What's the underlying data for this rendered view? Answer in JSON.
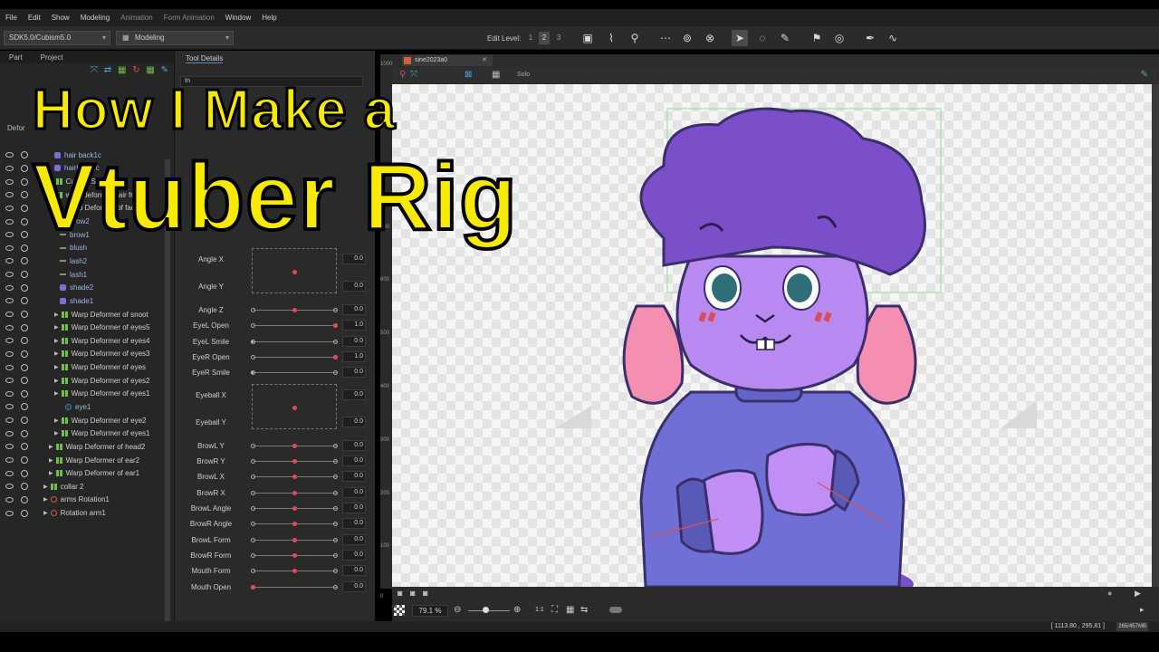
{
  "menu": [
    {
      "label": "File",
      "enabled": true
    },
    {
      "label": "Edit",
      "enabled": true
    },
    {
      "label": "Show",
      "enabled": true
    },
    {
      "label": "Modeling",
      "enabled": true
    },
    {
      "label": "Animation",
      "enabled": false
    },
    {
      "label": "Form Animation",
      "enabled": false
    },
    {
      "label": "Window",
      "enabled": true
    },
    {
      "label": "Help",
      "enabled": true
    }
  ],
  "toolbar": {
    "sdk_select": "SDK5.0/Cubism5.0",
    "mode_select": "Modeling",
    "edit_level_label": "Edit Level:",
    "edit_levels": [
      "1",
      "2",
      "3"
    ],
    "active_edit_level": "2"
  },
  "left_panel": {
    "tabs": [
      "Part",
      "Project"
    ],
    "deformer_tab": "Defor",
    "tree": [
      {
        "label": "hair back1c",
        "icon": "art",
        "indent": 60,
        "blue": true
      },
      {
        "label": "hairback2c",
        "icon": "art",
        "indent": 60,
        "blue": true
      },
      {
        "label": "Curved Surface2",
        "icon": "warp",
        "indent": 54,
        "arrow": true
      },
      {
        "label": "warp deformer hair front",
        "icon": "warp",
        "indent": 54,
        "arrow": true
      },
      {
        "label": "Warp Deformer of face",
        "icon": "warp",
        "indent": 54,
        "arrow": true
      },
      {
        "label": "brow2",
        "icon": "line",
        "indent": 66,
        "blue": true
      },
      {
        "label": "brow1",
        "icon": "line",
        "indent": 66,
        "blue": true
      },
      {
        "label": "blush",
        "icon": "line",
        "indent": 66,
        "blue": true
      },
      {
        "label": "lash2",
        "icon": "line",
        "indent": 66,
        "blue": true
      },
      {
        "label": "lash1",
        "icon": "line",
        "indent": 66,
        "blue": true
      },
      {
        "label": "shade2",
        "icon": "art",
        "indent": 66,
        "blue": true
      },
      {
        "label": "shade1",
        "icon": "art",
        "indent": 66,
        "blue": true
      },
      {
        "label": "Warp Deformer of snoot",
        "icon": "warp",
        "indent": 60,
        "arrow": true
      },
      {
        "label": "Warp Deformer of eyes5",
        "icon": "warp",
        "indent": 60,
        "arrow": true
      },
      {
        "label": "Warp Deformer of eyes4",
        "icon": "warp",
        "indent": 60,
        "arrow": true
      },
      {
        "label": "Warp Deformer of eyes3",
        "icon": "warp",
        "indent": 60,
        "arrow": true
      },
      {
        "label": "Warp Deformer of eyes",
        "icon": "warp",
        "indent": 60,
        "arrow": true
      },
      {
        "label": "Warp Deformer of eyes2",
        "icon": "warp",
        "indent": 60,
        "arrow": true
      },
      {
        "label": "Warp Deformer of eyes1",
        "icon": "warp",
        "indent": 60,
        "arrow": true
      },
      {
        "label": "eye1",
        "icon": "eye1",
        "indent": 72,
        "blue": true
      },
      {
        "label": "Warp Deformer of eye2",
        "icon": "warp",
        "indent": 60,
        "arrow": true
      },
      {
        "label": "Warp Deformer of eyes1",
        "icon": "warp",
        "indent": 60,
        "arrow": true
      },
      {
        "label": "Warp Deformer of head2",
        "icon": "warp",
        "indent": 54,
        "arrow": true
      },
      {
        "label": "Warp Deformer of ear2",
        "icon": "warp",
        "indent": 54,
        "arrow": true
      },
      {
        "label": "Warp Deformer of ear1",
        "icon": "warp",
        "indent": 54,
        "arrow": true
      },
      {
        "label": "collar 2",
        "icon": "warp",
        "indent": 48,
        "arrow": true
      },
      {
        "label": "arms Rotation1",
        "icon": "rot",
        "indent": 48,
        "arrow": true
      },
      {
        "label": "Rotation arm1",
        "icon": "rot",
        "indent": 48,
        "arrow": true
      }
    ]
  },
  "tool_details": {
    "tab": "Tool Details",
    "field_stub": "In"
  },
  "parameters": [
    {
      "name": "Angle X",
      "type": "2d",
      "value": "0.0"
    },
    {
      "name": "Angle Y",
      "type": "2d-y",
      "value": "0.0"
    },
    {
      "name": "Angle Z",
      "type": "slider",
      "value": "0.0",
      "pos": 0.5
    },
    {
      "name": "EyeL Open",
      "type": "slider",
      "value": "1.0",
      "pos": 1.0
    },
    {
      "name": "EyeL Smile",
      "type": "slider",
      "value": "0.0",
      "pos": 0.0
    },
    {
      "name": "EyeR Open",
      "type": "slider",
      "value": "1.0",
      "pos": 1.0
    },
    {
      "name": "EyeR Smile",
      "type": "slider",
      "value": "0.0",
      "pos": 0.0
    },
    {
      "name": "Eyeball X",
      "type": "2d",
      "value": "0.0"
    },
    {
      "name": "Eyeball Y",
      "type": "2d-y",
      "value": "0.0"
    },
    {
      "name": "BrowL Y",
      "type": "slider",
      "value": "0.0",
      "pos": 0.5
    },
    {
      "name": "BrowR Y",
      "type": "slider",
      "value": "0.0",
      "pos": 0.5
    },
    {
      "name": "BrowL X",
      "type": "slider",
      "value": "0.0",
      "pos": 0.5
    },
    {
      "name": "BrowR X",
      "type": "slider",
      "value": "0.0",
      "pos": 0.5
    },
    {
      "name": "BrowL Angle",
      "type": "slider",
      "value": "0.0",
      "pos": 0.5
    },
    {
      "name": "BrowR Angle",
      "type": "slider",
      "value": "0.0",
      "pos": 0.5
    },
    {
      "name": "BrowL Form",
      "type": "slider",
      "value": "0.0",
      "pos": 0.5
    },
    {
      "name": "BrowR Form",
      "type": "slider",
      "value": "0.0",
      "pos": 0.5
    },
    {
      "name": "Mouth Form",
      "type": "slider",
      "value": "0.0",
      "pos": 0.5
    },
    {
      "name": "Mouth Open",
      "type": "slider",
      "value": "0.0",
      "pos": 0.0
    }
  ],
  "viewport": {
    "doc_tab": "sine2023a0",
    "solo_label": "Solo",
    "zoom": "79.1",
    "zoom_unit": "%",
    "ratio_label": "1:1",
    "ruler_marks": [
      "1000",
      "800",
      "700",
      "600",
      "500",
      "400",
      "300",
      "200",
      "100",
      "0"
    ]
  },
  "status": {
    "coords": "[ 1113.80 ,  295.81 ]",
    "memory": "265/457MB"
  },
  "overlay_title": {
    "line1": "How I Make a",
    "line2": "Vtuber Rig"
  },
  "colors": {
    "title_yellow": "#f7ea00",
    "knob_red": "#e0495a",
    "hair_purple": "#7a4fc9",
    "skin_lilac": "#b889f0",
    "ear_pink": "#f48fb1",
    "sweater_blue": "#6f6fd6",
    "eye_teal": "#2f6f78"
  }
}
